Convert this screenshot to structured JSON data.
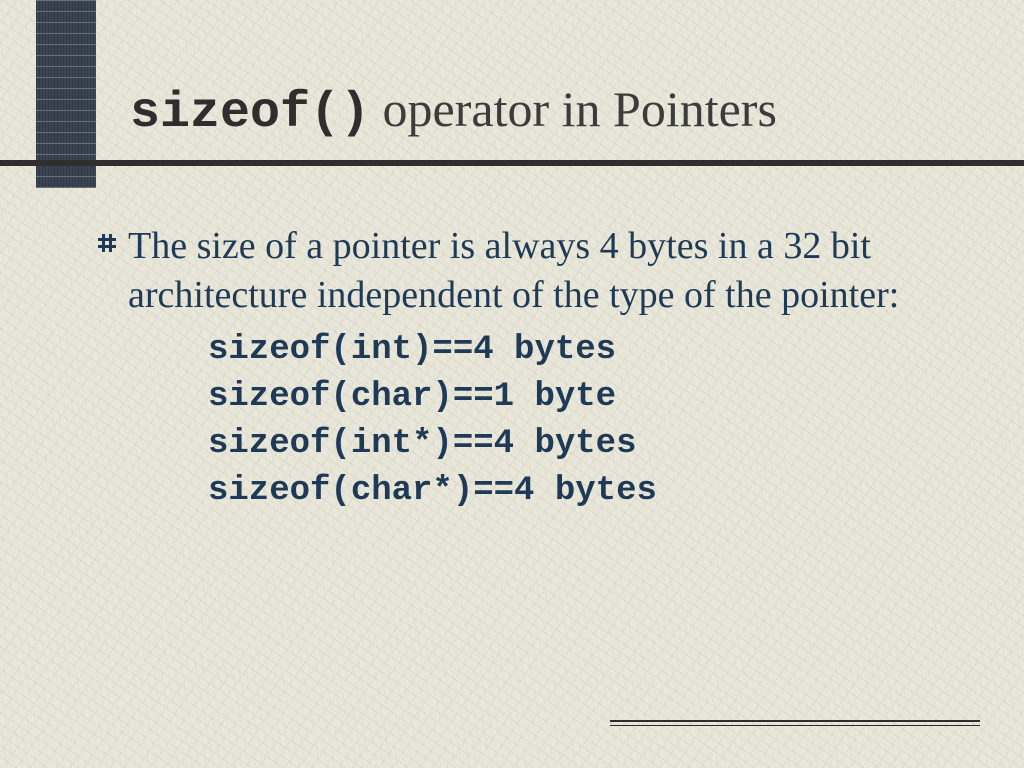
{
  "title": {
    "mono": "sizeof()",
    "rest": " operator in Pointers"
  },
  "bullet_text": "The size of a pointer is always 4 bytes in a 32 bit architecture independent of the type of the pointer:",
  "code": {
    "l1": "sizeof(int)==4 bytes",
    "l2": "sizeof(char)==1 byte",
    "l3": "sizeof(int*)==4 bytes",
    "l4": "sizeof(char*)==4 bytes"
  }
}
